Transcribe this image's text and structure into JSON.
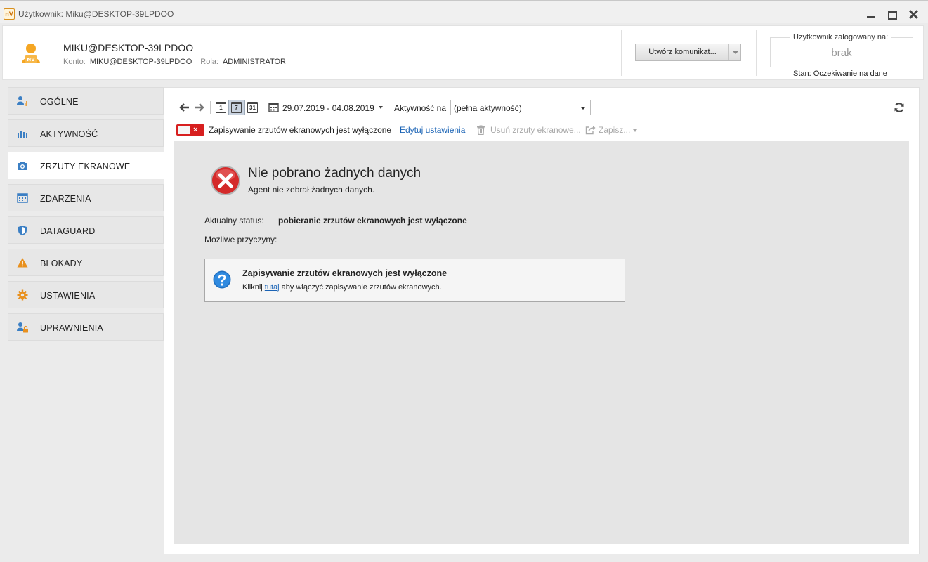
{
  "window": {
    "title": "Użytkownik: Miku@DESKTOP-39LPDOO",
    "app_icon": "nV"
  },
  "header": {
    "user_name": "MIKU@DESKTOP-39LPDOO",
    "account_label": "Konto:",
    "account_value": "MIKU@DESKTOP-39LPDOO",
    "role_label": "Rola:",
    "role_value": "ADMINISTRATOR",
    "create_message_label": "Utwórz komunikat...",
    "logged_in_label": "Użytkownik zalogowany na:",
    "logged_in_value": "brak",
    "status_text": "Stan: Oczekiwanie na dane",
    "avatar_badge": "NV"
  },
  "sidebar": {
    "items": [
      {
        "label": "OGÓLNE",
        "icon": "user-chart-icon",
        "active": false
      },
      {
        "label": "AKTYWNOŚĆ",
        "icon": "bar-chart-icon",
        "active": false
      },
      {
        "label": "ZRZUTY EKRANOWE",
        "icon": "camera-icon",
        "active": true
      },
      {
        "label": "ZDARZENIA",
        "icon": "calendar-grid-icon",
        "active": false
      },
      {
        "label": "DATAGUARD",
        "icon": "shield-icon",
        "active": false
      },
      {
        "label": "BLOKADY",
        "icon": "warning-icon",
        "active": false
      },
      {
        "label": "USTAWIENIA",
        "icon": "gear-icon",
        "active": false
      },
      {
        "label": "UPRAWNIENIA",
        "icon": "user-lock-icon",
        "active": false
      }
    ]
  },
  "toolbar": {
    "day_icon_text": "1",
    "week_icon_text": "7",
    "month_icon_text": "31",
    "date_range": "29.07.2019 - 04.08.2019",
    "activity_label": "Aktywność na",
    "activity_value": "(pełna aktywność)"
  },
  "toolbar2": {
    "toggle_x": "×",
    "capture_status": "Zapisywanie zrzutów ekranowych jest wyłączone",
    "edit_settings": "Edytuj ustawienia",
    "delete_screenshots": "Usuń zrzuty ekranowe...",
    "save_label": "Zapisz..."
  },
  "message": {
    "title": "Nie pobrano żadnych danych",
    "subtitle": "Agent nie zebrał żadnych danych.",
    "status_label": "Aktualny status:",
    "status_value": "pobieranie zrzutów ekranowych jest wyłączone",
    "reasons_label": "Możliwe przyczyny:",
    "reason_title": "Zapisywanie zrzutów ekranowych jest wyłączone",
    "reason_desc_before": "Kliknij",
    "reason_link": "tutaj",
    "reason_desc_after": "aby włączyć zapisywanie zrzutów ekranowych."
  },
  "colors": {
    "accent_blue": "#1a63b5",
    "error_red": "#d71f1f",
    "icon_orange": "#e8901e",
    "icon_blue": "#3b7fc4"
  }
}
